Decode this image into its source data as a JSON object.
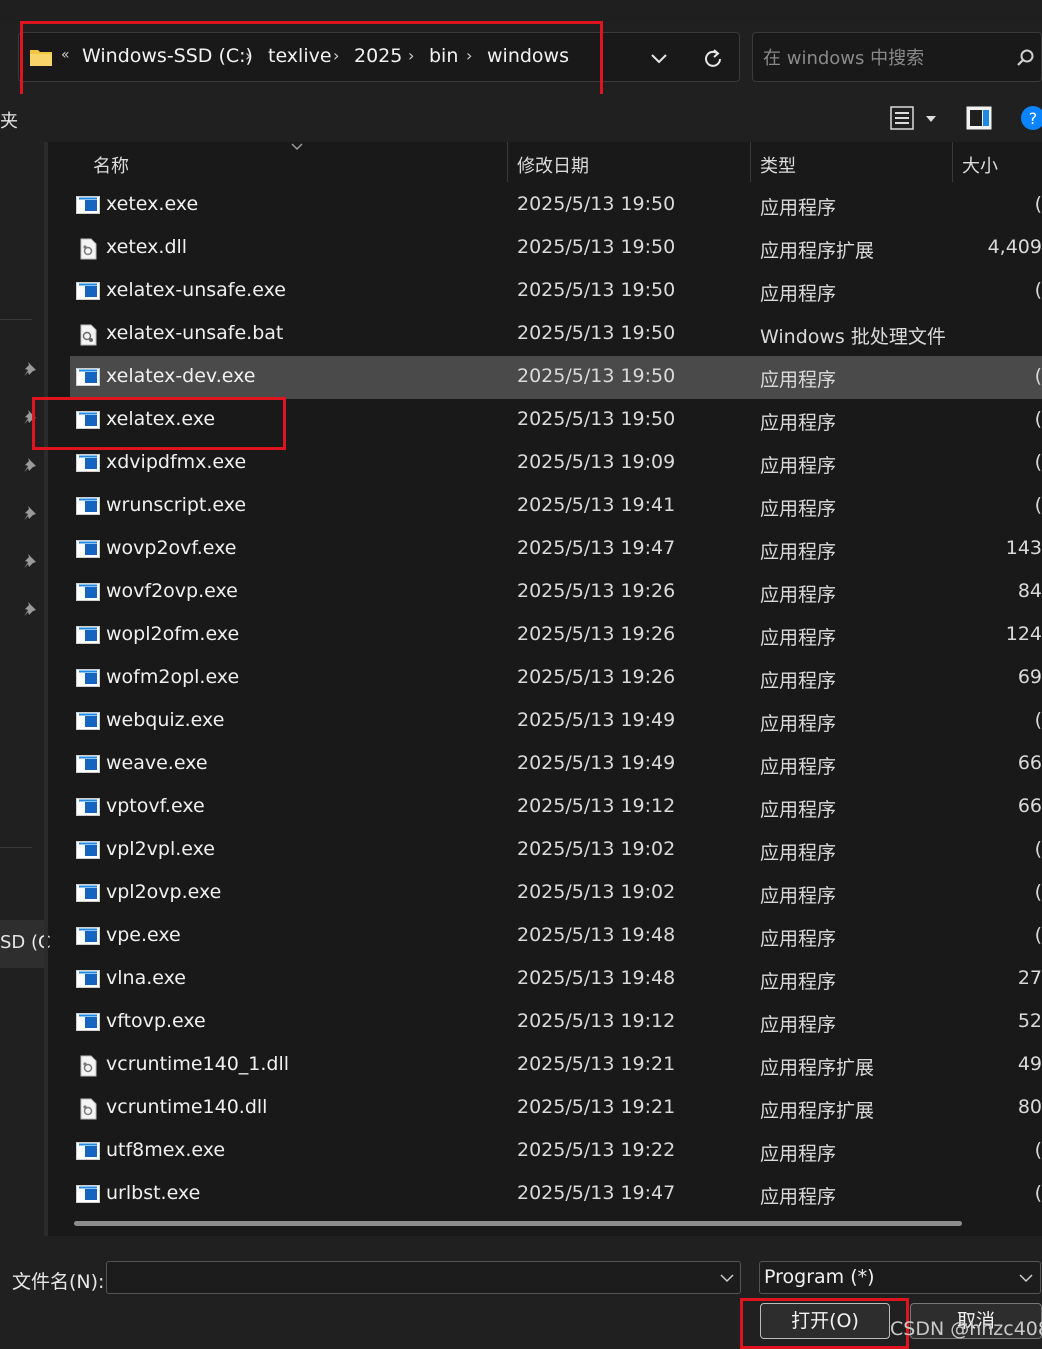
{
  "address": {
    "crumbs": [
      "Windows-SSD (C:)",
      "texlive",
      "2025",
      "bin",
      "windows"
    ],
    "back_chevrons": "«"
  },
  "search": {
    "placeholder": "在 windows 中搜索"
  },
  "toolbar": {
    "left_fragment": "夹"
  },
  "sidebar": {
    "drive_fragment": "SD (C"
  },
  "columns": {
    "name": "名称",
    "date": "修改日期",
    "type": "类型",
    "size": "大小"
  },
  "files": [
    {
      "name": "xetex.exe",
      "date": "2025/5/13 19:50",
      "type": "应用程序",
      "size": "(",
      "icon": "exe"
    },
    {
      "name": "xetex.dll",
      "date": "2025/5/13 19:50",
      "type": "应用程序扩展",
      "size": "4,409",
      "icon": "dll"
    },
    {
      "name": "xelatex-unsafe.exe",
      "date": "2025/5/13 19:50",
      "type": "应用程序",
      "size": "(",
      "icon": "exe"
    },
    {
      "name": "xelatex-unsafe.bat",
      "date": "2025/5/13 19:50",
      "type": "Windows 批处理文件",
      "size": "",
      "icon": "bat"
    },
    {
      "name": "xelatex-dev.exe",
      "date": "2025/5/13 19:50",
      "type": "应用程序",
      "size": "(",
      "icon": "exe"
    },
    {
      "name": "xelatex.exe",
      "date": "2025/5/13 19:50",
      "type": "应用程序",
      "size": "(",
      "icon": "exe"
    },
    {
      "name": "xdvipdfmx.exe",
      "date": "2025/5/13 19:09",
      "type": "应用程序",
      "size": "(",
      "icon": "exe"
    },
    {
      "name": "wrunscript.exe",
      "date": "2025/5/13 19:41",
      "type": "应用程序",
      "size": "(",
      "icon": "exe"
    },
    {
      "name": "wovp2ovf.exe",
      "date": "2025/5/13 19:47",
      "type": "应用程序",
      "size": "143",
      "icon": "exe"
    },
    {
      "name": "wovf2ovp.exe",
      "date": "2025/5/13 19:26",
      "type": "应用程序",
      "size": "84",
      "icon": "exe"
    },
    {
      "name": "wopl2ofm.exe",
      "date": "2025/5/13 19:26",
      "type": "应用程序",
      "size": "124",
      "icon": "exe"
    },
    {
      "name": "wofm2opl.exe",
      "date": "2025/5/13 19:26",
      "type": "应用程序",
      "size": "69",
      "icon": "exe"
    },
    {
      "name": "webquiz.exe",
      "date": "2025/5/13 19:49",
      "type": "应用程序",
      "size": "(",
      "icon": "exe"
    },
    {
      "name": "weave.exe",
      "date": "2025/5/13 19:49",
      "type": "应用程序",
      "size": "66",
      "icon": "exe"
    },
    {
      "name": "vptovf.exe",
      "date": "2025/5/13 19:12",
      "type": "应用程序",
      "size": "66",
      "icon": "exe"
    },
    {
      "name": "vpl2vpl.exe",
      "date": "2025/5/13 19:02",
      "type": "应用程序",
      "size": "(",
      "icon": "exe"
    },
    {
      "name": "vpl2ovp.exe",
      "date": "2025/5/13 19:02",
      "type": "应用程序",
      "size": "(",
      "icon": "exe"
    },
    {
      "name": "vpe.exe",
      "date": "2025/5/13 19:48",
      "type": "应用程序",
      "size": "(",
      "icon": "exe"
    },
    {
      "name": "vlna.exe",
      "date": "2025/5/13 19:48",
      "type": "应用程序",
      "size": "27",
      "icon": "exe"
    },
    {
      "name": "vftovp.exe",
      "date": "2025/5/13 19:12",
      "type": "应用程序",
      "size": "52",
      "icon": "exe"
    },
    {
      "name": "vcruntime140_1.dll",
      "date": "2025/5/13 19:21",
      "type": "应用程序扩展",
      "size": "49",
      "icon": "dll"
    },
    {
      "name": "vcruntime140.dll",
      "date": "2025/5/13 19:21",
      "type": "应用程序扩展",
      "size": "80",
      "icon": "dll"
    },
    {
      "name": "utf8mex.exe",
      "date": "2025/5/13 19:22",
      "type": "应用程序",
      "size": "(",
      "icon": "exe"
    },
    {
      "name": "urlbst.exe",
      "date": "2025/5/13 19:47",
      "type": "应用程序",
      "size": "(",
      "icon": "exe"
    }
  ],
  "selected_file": "xelatex-dev.exe",
  "bottom": {
    "filename_label": "文件名(N):",
    "filename_value": "",
    "filetype_value": "Program (*)",
    "open_label": "打开(O)",
    "cancel_label": "取消"
  },
  "watermark": "CSDN @hnzc408",
  "colors": {
    "highlight": "#e0141e",
    "accent": "#0a84ff",
    "folder": "#f4c542"
  }
}
